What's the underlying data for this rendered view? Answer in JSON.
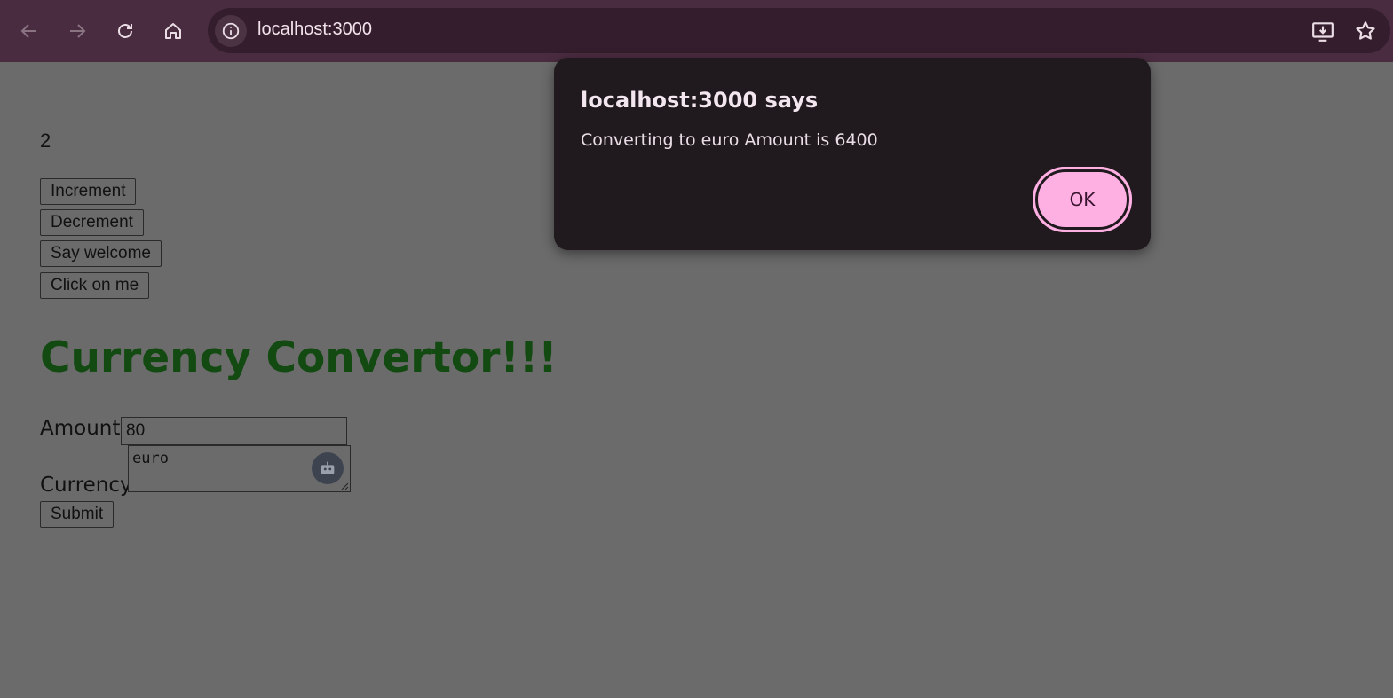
{
  "browser": {
    "url": "localhost:3000"
  },
  "page": {
    "counter_value": "2",
    "buttons": {
      "increment": "Increment",
      "decrement": "Decrement",
      "say_welcome": "Say welcome",
      "click_on_me": "Click on me"
    },
    "heading": "Currency Convertor!!!",
    "form": {
      "amount_label": "Amount:",
      "amount_value": "80",
      "currency_label": "Currency:",
      "currency_value": "euro",
      "submit_label": "Submit"
    }
  },
  "dialog": {
    "title": "localhost:3000 says",
    "message": "Converting to euro Amount is 6400",
    "ok_label": "OK"
  },
  "colors": {
    "heading": "#124a12",
    "accent": "#ffb0e3",
    "toolbar": "#4a2c40"
  }
}
